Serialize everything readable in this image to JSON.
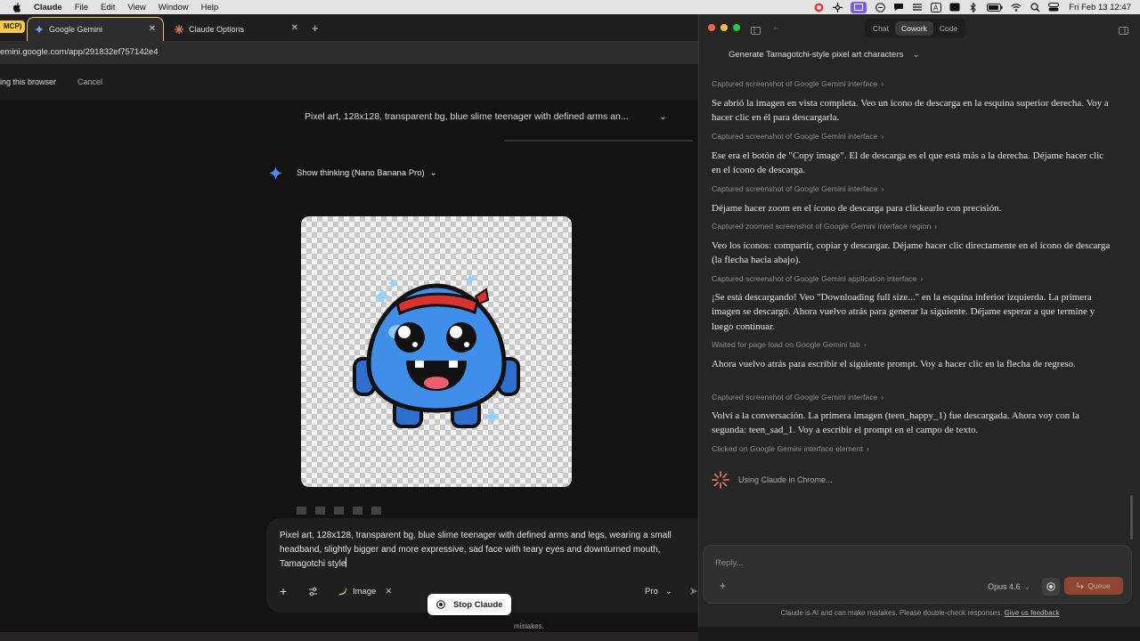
{
  "menubar": {
    "app_name": "Claude",
    "items": [
      "File",
      "Edit",
      "View",
      "Window",
      "Help"
    ],
    "clock": "Fri Feb 13  12:47",
    "status_icons": [
      "record-icon",
      "extension-icon",
      "screen-icon",
      "globe-icon",
      "chat-icon",
      "menu-icon",
      "text-input-icon",
      "mail-icon",
      "bluetooth-icon",
      "battery-icon",
      "wifi-icon",
      "search-icon",
      "control-center-icon"
    ]
  },
  "browser": {
    "mcp_badge": "MCP)",
    "tabs": [
      {
        "label": "Google Gemini",
        "active": true
      },
      {
        "label": "Claude Options",
        "active": false
      }
    ],
    "url": "emini.google.com/app/291832ef757142e4",
    "infobar": {
      "text": "ing this browser",
      "cancel": "Cancel"
    }
  },
  "gemini": {
    "prompt_header": "Pixel art, 128x128, transparent bg, blue slime teenager with defined arms an...",
    "thinking_label": "Show thinking (Nano Banana Pro)",
    "composer_text": "Pixel art, 128x128, transparent bg, blue slime teenager with defined arms and legs, wearing a small headband, slightly bigger and more expressive, sad face with teary eyes and downturned mouth, Tamagotchi style",
    "tool_image": "Image",
    "model": "Pro",
    "stop_button": "Stop Claude",
    "disclaimer_fragment": "mistakes."
  },
  "claude": {
    "modes": [
      "Chat",
      "Cowork",
      "Code"
    ],
    "active_mode": "Cowork",
    "task_title": "Generate Tamagotchi-style pixel art characters",
    "log": [
      {
        "type": "step",
        "text": "Captured screenshot of Google Gemini interface"
      },
      {
        "type": "msg",
        "text": "Se abrió la imagen en vista completa. Veo un ícono de descarga en la esquina superior derecha. Voy a hacer clic en él para descargarla."
      },
      {
        "type": "step",
        "text": "Captured screenshot of Google Gemini interface"
      },
      {
        "type": "msg",
        "text": "Ese era el botón de \"Copy image\". El de descarga es el que está más a la derecha. Déjame hacer clic en el ícono de descarga."
      },
      {
        "type": "step",
        "text": "Captured screenshot of Google Gemini interface"
      },
      {
        "type": "msg",
        "text": "Déjame hacer zoom en el ícono de descarga para clickearlo con precisión."
      },
      {
        "type": "step",
        "text": "Captured zoomed screenshot of Google Gemini interface region"
      },
      {
        "type": "msg",
        "text": "Veo los íconos: compartir, copiar y descargar. Déjame hacer clic directamente en el ícono de descarga (la flecha hacia abajo)."
      },
      {
        "type": "step",
        "text": "Captured screenshot of Google Gemini application interface"
      },
      {
        "type": "msg",
        "text": "¡Se está descargando! Veo \"Downloading full size...\" en la esquina inferior izquierda. La primera imagen se descargó. Ahora vuelvo atrás para generar la siguiente. Déjame esperar a que termine y luego continuar."
      },
      {
        "type": "step",
        "text": "Waited for page load on Google Gemini tab"
      },
      {
        "type": "msg",
        "text": "Ahora vuelvo atrás para escribir el siguiente prompt. Voy a hacer clic en la flecha de regreso."
      },
      {
        "type": "step",
        "text": "Captured screenshot of Google Gemini interface"
      },
      {
        "type": "msg",
        "text": "Volví a la conversación. La primera imagen (teen_happy_1) fue descargada. Ahora voy con la segunda: teen_sad_1. Voy a escribir el prompt en el campo de texto."
      },
      {
        "type": "step",
        "text": "Clicked on Google Gemini interface element"
      }
    ],
    "status": "Using Claude in Chrome...",
    "input_placeholder": "Reply...",
    "model": "Opus 4.6",
    "queue_button": "Queue",
    "disclaimer": "Claude is AI and can make mistakes. Please double-check responses.",
    "feedback_link": "Give us feedback"
  }
}
